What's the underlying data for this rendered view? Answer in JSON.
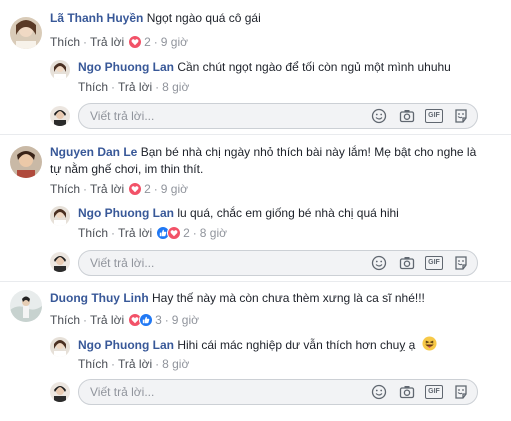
{
  "threads": [
    {
      "comment": {
        "author": "Lã Thanh Huyền",
        "text": "Ngọt ngào quá cô gái",
        "text2": "",
        "reaction_count": "2",
        "time": "9 giờ"
      },
      "reply": {
        "author": "Ngo Phuong Lan",
        "text": "Cần chút ngọt ngào để tối còn ngủ một mình uhuhu",
        "reaction_count": "",
        "time": "8 giờ"
      }
    },
    {
      "comment": {
        "author": "Nguyen Dan Le",
        "text": "Bạn bé nhà chị ngày nhỏ thích bài này lắm! Mẹ bật cho nghe là",
        "text2": "tự nằm ghế chơi, im thin thít.",
        "reaction_count": "2",
        "time": "9 giờ"
      },
      "reply": {
        "author": "Ngo Phuong Lan",
        "text": "lu quá, chắc em giống bé nhà chị quá hihi",
        "reaction_count": "2",
        "time": "8 giờ"
      }
    },
    {
      "comment": {
        "author": "Duong Thuy Linh",
        "text": "Hay thế này mà còn chưa thèm xưng là ca sĩ nhé!!!",
        "text2": "",
        "reaction_count": "3",
        "time": "9 giờ"
      },
      "reply": {
        "author": "Ngo Phuong Lan",
        "text": "Hihi cái mác nghiệp dư vẫn thích hơn chuỵ ạ",
        "reaction_count": "",
        "time": "8 giờ"
      }
    }
  ],
  "actions": {
    "like": "Thích",
    "reply": "Trả lời",
    "dot": "·"
  },
  "reply_placeholder": "Viết trả lời...",
  "gif_label": "GIF",
  "colors": {
    "name": "#385898",
    "like_blue": "#2078f4",
    "heart_red": "#f25268",
    "wow_yellow": "#f7b125"
  }
}
